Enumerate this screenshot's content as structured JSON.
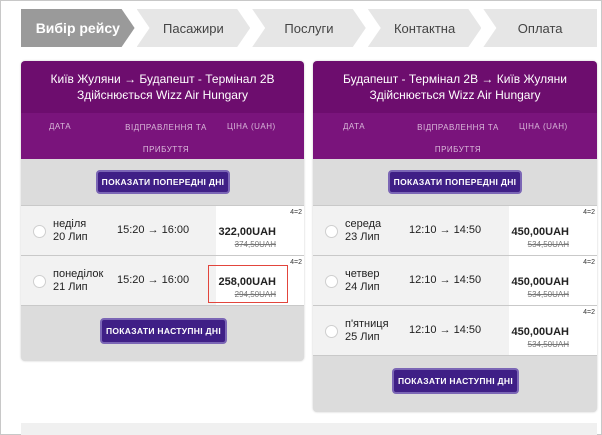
{
  "steps": [
    {
      "label": "Вибір рейсу",
      "active": true
    },
    {
      "label": "Пасажири"
    },
    {
      "label": "Послуги"
    },
    {
      "label": "Контактна"
    },
    {
      "label": "Оплата"
    }
  ],
  "columns": {
    "date": "ДАТА",
    "dep": "ВІДПРАВЛЕННЯ ТА ПРИБУТТЯ",
    "price": "ЦІНА (UAH)"
  },
  "outbound": {
    "route": "Київ Жуляни → Будапешт - Термінал 2B",
    "operator": "Здійснюється Wizz Air Hungary",
    "prev_button": "ПОКАЗАТИ ПОПЕРЕДНІ ДНІ",
    "next_button": "ПОКАЗАТИ НАСТУПНІ ДНІ",
    "flights": [
      {
        "weekday": "неділя",
        "date": "20 Лип",
        "time": "15:20 → 16:00",
        "price": "322,00UAH",
        "old_price": "374,50UAH",
        "tag": "4=2"
      },
      {
        "weekday": "понеділок",
        "date": "21 Лип",
        "time": "15:20 → 16:00",
        "price": "258,00UAH",
        "old_price": "294,50UAH",
        "tag": "4=2"
      }
    ]
  },
  "inbound": {
    "route": "Будапешт - Термінал 2B → Київ Жуляни",
    "operator": "Здійснюється Wizz Air Hungary",
    "prev_button": "ПОКАЗАТИ ПОПЕРЕДНІ ДНІ",
    "next_button": "ПОКАЗАТИ НАСТУПНІ ДНІ",
    "flights": [
      {
        "weekday": "середа",
        "date": "23 Лип",
        "time": "12:10 → 14:50",
        "price": "450,00UAH",
        "old_price": "534,50UAH",
        "tag": "4=2"
      },
      {
        "weekday": "четвер",
        "date": "24 Лип",
        "time": "12:10 → 14:50",
        "price": "450,00UAH",
        "old_price": "534,50UAH",
        "tag": "4=2"
      },
      {
        "weekday": "п'ятниця",
        "date": "25 Лип",
        "time": "12:10 → 14:50",
        "price": "450,00UAH",
        "old_price": "534,50UAH",
        "tag": "4=2"
      }
    ]
  },
  "colors": {
    "header_purple": "#6d0d6e",
    "button_indigo": "#3f1f86",
    "highlight_red": "#e2453c"
  }
}
